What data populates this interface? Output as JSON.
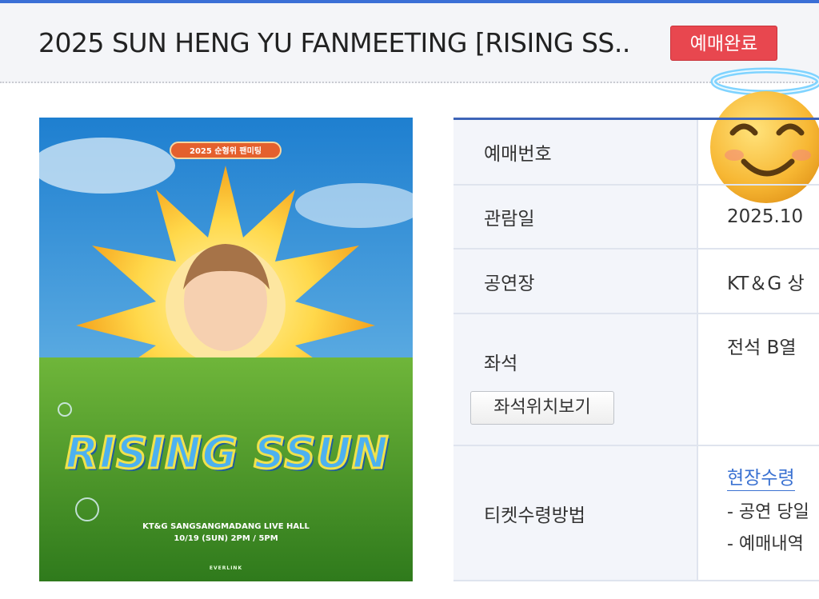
{
  "header": {
    "title": "2025 SUN HENG YU FANMEETING  [RISING SS..",
    "badge": "예매완료",
    "accent_color": "#3b6fd6",
    "badge_color": "#e8474f"
  },
  "sticker": {
    "icon": "smiling-face-with-halo-icon"
  },
  "poster": {
    "top_label": "2025 순형위 팬미팅",
    "headline": "RISING SSUN",
    "venue": "KT&G SANGSANGMADANG LIVE HALL",
    "datetime": "10/19 (SUN) 2PM / 5PM",
    "brand": "EVERLINK"
  },
  "table": {
    "rows": [
      {
        "label": "예매번호",
        "value": ""
      },
      {
        "label": "관람일",
        "value": "2025.10"
      },
      {
        "label": "공연장",
        "value": "KT＆G 상"
      },
      {
        "label": "좌석",
        "value": "전석 B열",
        "button": "좌석위치보기"
      },
      {
        "label": "티켓수령방법",
        "link": "현장수령",
        "notes": [
          "- 공연 당일",
          "- 예매내역"
        ]
      }
    ]
  }
}
